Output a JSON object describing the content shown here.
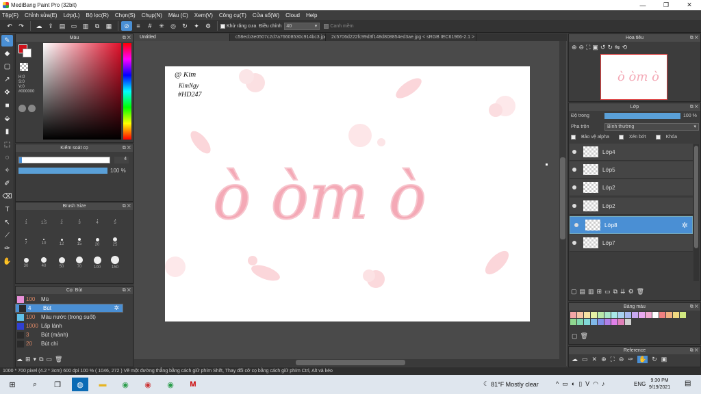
{
  "window": {
    "title": "MediBang Paint Pro (32bit)",
    "minimize": "—",
    "maximize": "❐",
    "close": "✕"
  },
  "menu": [
    "Tệp(F)",
    "Chỉnh sửa(E)",
    "Lớp(L)",
    "Bộ lọc(R)",
    "Chọn(S)",
    "Chụp(N)",
    "Màu (C)",
    "Xem(V)",
    "Công cụ(T)",
    "Cửa sổ(W)",
    "Cloud",
    "Help"
  ],
  "toolbar": {
    "antialias_label": "Khử răng cưa",
    "adjust_label": "Điều chỉnh",
    "adjust_value": "40",
    "smooth_label": "Canh mềm"
  },
  "tabs": [
    "Untitled",
    "c58ecb3e0507c2d7a76608530c914bc3.jpg",
    "2c5706d222fc99d3f148d808854ed3ae.jpg < sRGB IEC61966-2.1 >"
  ],
  "color_panel": {
    "title": "Màu",
    "h": "H:0",
    "s": "S:0",
    "v": "V:0",
    "hex": "#000000",
    "primary": "#d0101a",
    "secondary": "#ffffff"
  },
  "stroke_panel": {
    "title": "Kiểm soát cọ",
    "size_value": "4",
    "opacity_value": "100 %"
  },
  "brush_size_panel": {
    "title": "Brush Size",
    "rows": [
      [
        "1",
        "1.5",
        "2",
        "3",
        "4",
        "5"
      ],
      [
        "7",
        "10",
        "12",
        "15",
        "20",
        "25"
      ],
      [
        "30",
        "40",
        "50",
        "70",
        "100",
        "150"
      ]
    ]
  },
  "brush_panel": {
    "title": "Cọ: Bút",
    "items": [
      {
        "size": "100",
        "name": "Mù",
        "color": "#e890d8"
      },
      {
        "size": "4",
        "name": "Bút",
        "color": "#2a2a2a"
      },
      {
        "size": "100",
        "name": "Màu nước (trong suốt)",
        "color": "#60c0e8"
      },
      {
        "size": "1000",
        "name": "Lấp lánh",
        "color": "#3040d0"
      },
      {
        "size": "3",
        "name": "Bút (mảnh)",
        "color": "#2a2a2a"
      },
      {
        "size": "20",
        "name": "Bút chì",
        "color": "#2a2a2a"
      }
    ]
  },
  "canvas": {
    "signature_line1": "@ Kim",
    "signature_line2": "KimNgy",
    "signature_line3": "#HD247",
    "artwork_text": "ò òm ò"
  },
  "navigator": {
    "title": "Hoa tiêu"
  },
  "layer_panel": {
    "title": "Lớp",
    "opacity_label": "Độ trong",
    "opacity_value": "100 %",
    "blend_label": "Pha trộn",
    "blend_value": "Bình thường",
    "protect_alpha": "Bảo vệ alpha",
    "clipping": "Xén bớt",
    "lock": "Khóa",
    "layers": [
      "Lớp4",
      "Lớp5",
      "Lớp2",
      "Lớp2",
      "Lớp8",
      "Lớp7"
    ],
    "selected_index": 4
  },
  "palette_panel": {
    "title": "Bảng màu",
    "swatches": [
      "#f4a6a6",
      "#f6c3a4",
      "#f6e1a2",
      "#e4f0a4",
      "#b8e8a8",
      "#a8e8c8",
      "#a8e8e8",
      "#a8d0f0",
      "#a8b8f0",
      "#c8a8f0",
      "#e8a8f0",
      "#f0a8d0",
      "#ffffff",
      "#f08080",
      "#f0b080",
      "#f0d880",
      "#d0e880",
      "#90d890",
      "#80d8b0",
      "#80d8d8",
      "#80b8e8",
      "#8090e8",
      "#b080e8",
      "#e080e8",
      "#e080b8",
      "#d0d0d0"
    ]
  },
  "reference_panel": {
    "title": "Reference"
  },
  "status": "1000 * 700 pixel  (4.2 * 3cm)  600 dpi  100 %  ( 1046, 272 )  Vẽ một đường thẳng bằng cách giữ phím Shift, Thay đổi cỡ cọ bằng cách giữ phím Ctrl, Alt và kéo",
  "taskbar": {
    "weather": "81°F  Mostly clear",
    "lang": "ENG",
    "time": "9:30 PM",
    "date": "9/19/2021"
  }
}
